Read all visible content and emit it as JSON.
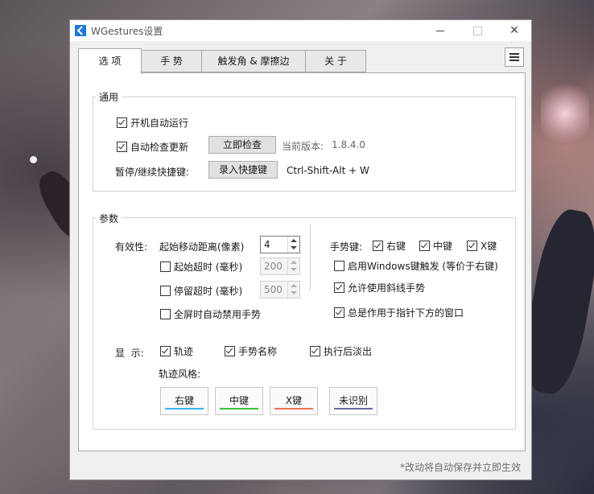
{
  "window": {
    "title": "WGestures设置"
  },
  "tabs": [
    "选 项",
    "手 势",
    "触发角 & 摩擦边",
    "关 于"
  ],
  "general": {
    "title": "通用",
    "autostart": {
      "label": "开机自动运行",
      "checked": true
    },
    "autoupdate": {
      "label": "自动检查更新",
      "checked": true
    },
    "check_now": "立即检查",
    "version_label": "当前版本:",
    "version": "1.8.4.0",
    "hotkey_label": "暂停/继续快捷键:",
    "record_hotkey": "录入快捷键",
    "hotkey_value": "Ctrl-Shift-Alt + W"
  },
  "params": {
    "title": "参数",
    "effectiveness_label": "有效性:",
    "start_distance_label": "起始移动距离(像素)",
    "start_distance": "4",
    "start_timeout": {
      "label": "起始超时 (毫秒)",
      "checked": false,
      "value": "200"
    },
    "stay_timeout": {
      "label": "停留超时 (毫秒)",
      "checked": false,
      "value": "500"
    },
    "fullscreen_disable": {
      "label": "全屏时自动禁用手势",
      "checked": false
    },
    "gesture_key_label": "手势键:",
    "right_key": {
      "label": "右键",
      "checked": true
    },
    "middle_key": {
      "label": "中键",
      "checked": true
    },
    "x_key": {
      "label": "X键",
      "checked": true
    },
    "windows_key": {
      "label": "启用Windows键触发 (等价于右键)",
      "checked": false
    },
    "diagonal": {
      "label": "允许使用斜线手势",
      "checked": true
    },
    "under_pointer": {
      "label": "总是作用于指针下方的窗口",
      "checked": true
    },
    "display_label": "显  示:",
    "trail": {
      "label": "轨迹",
      "checked": true
    },
    "gesture_name": {
      "label": "手势名称",
      "checked": true
    },
    "fade_after": {
      "label": "执行后淡出",
      "checked": true
    },
    "trail_style_label": "轨迹风格:",
    "styles": [
      {
        "label": "右键",
        "color": "#35b4f0"
      },
      {
        "label": "中键",
        "color": "#3cc43c"
      },
      {
        "label": "X键",
        "color": "#f07050"
      },
      {
        "label": "未识别",
        "color": "#6a6aa0"
      }
    ]
  },
  "footer": "*改动将自动保存并立即生效"
}
